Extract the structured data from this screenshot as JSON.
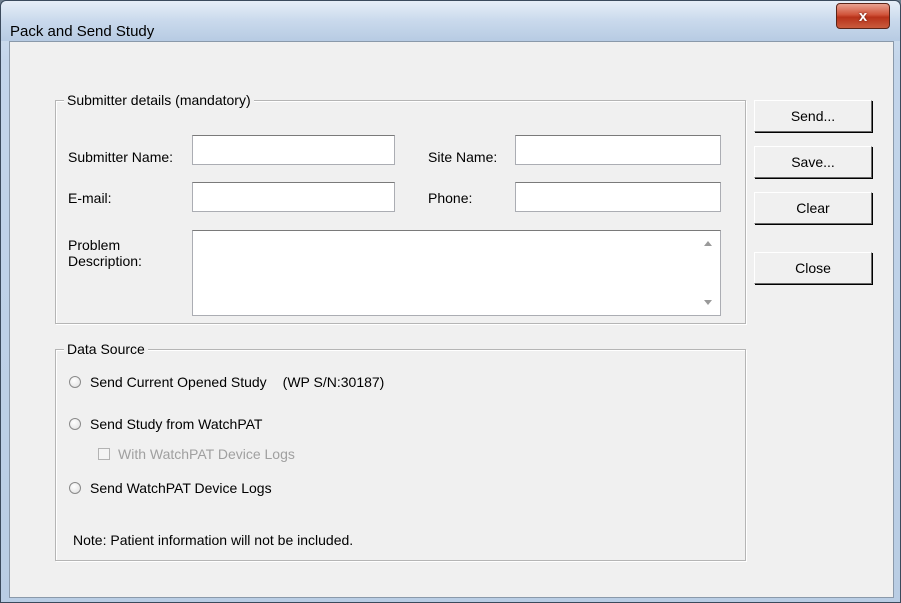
{
  "window": {
    "title": "Pack and Send Study",
    "close_label": "x"
  },
  "submitter": {
    "legend": "Submitter details (mandatory)",
    "name_label": "Submitter Name:",
    "name_value": "",
    "site_label": "Site Name:",
    "site_value": "",
    "email_label": "E-mail:",
    "email_value": "",
    "phone_label": "Phone:",
    "phone_value": "",
    "problem_label_line1": "Problem",
    "problem_label_line2": "Description:",
    "problem_value": ""
  },
  "data_source": {
    "legend": "Data Source",
    "opt_current": "Send Current Opened Study",
    "serial": "(WP S/N:30187)",
    "opt_watchpat": "Send Study from WatchPAT",
    "opt_device_logs_check": "With WatchPAT Device Logs",
    "opt_logs": "Send WatchPAT Device Logs",
    "note": "Note: Patient information will not be included."
  },
  "buttons": {
    "send": "Send...",
    "save": "Save...",
    "clear": "Clear",
    "close": "Close"
  }
}
